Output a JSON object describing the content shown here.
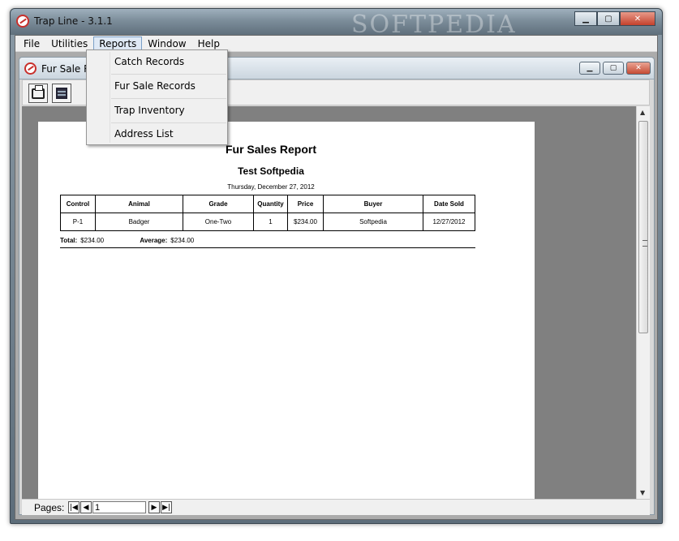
{
  "app": {
    "title": "Trap Line  -  3.1.1",
    "watermark": "SOFTPEDIA"
  },
  "window_buttons": {
    "minimize": "▁",
    "maximize": "▢",
    "close": "✕"
  },
  "menubar": {
    "items": [
      {
        "label": "File"
      },
      {
        "label": "Utilities"
      },
      {
        "label": "Reports"
      },
      {
        "label": "Window"
      },
      {
        "label": "Help"
      }
    ]
  },
  "reports_menu": {
    "items": [
      {
        "label": "Catch Records"
      },
      {
        "label": "Fur Sale Records"
      },
      {
        "label": "Trap Inventory"
      },
      {
        "label": "Address List"
      }
    ]
  },
  "child_window": {
    "title": "Fur Sale Re"
  },
  "toolbar": {
    "print_icon": "printer-icon",
    "export_icon": "export-icon"
  },
  "report": {
    "title": "Fur Sales Report",
    "subtitle": "Test Softpedia",
    "date": "Thursday, December 27, 2012",
    "columns": [
      "Control",
      "Animal",
      "Grade",
      "Quantity",
      "Price",
      "Buyer",
      "Date Sold"
    ],
    "rows": [
      [
        "P-1",
        "Badger",
        "One-Two",
        "1",
        "$234.00",
        "Softpedia",
        "12/27/2012"
      ]
    ],
    "totals": {
      "total_label": "Total:",
      "total_value": "$234.00",
      "average_label": "Average:",
      "average_value": "$234.00"
    }
  },
  "pager": {
    "label": "Pages:",
    "value": "1",
    "first": "|◀",
    "prev": "◀",
    "next": "▶",
    "last": "▶|"
  }
}
